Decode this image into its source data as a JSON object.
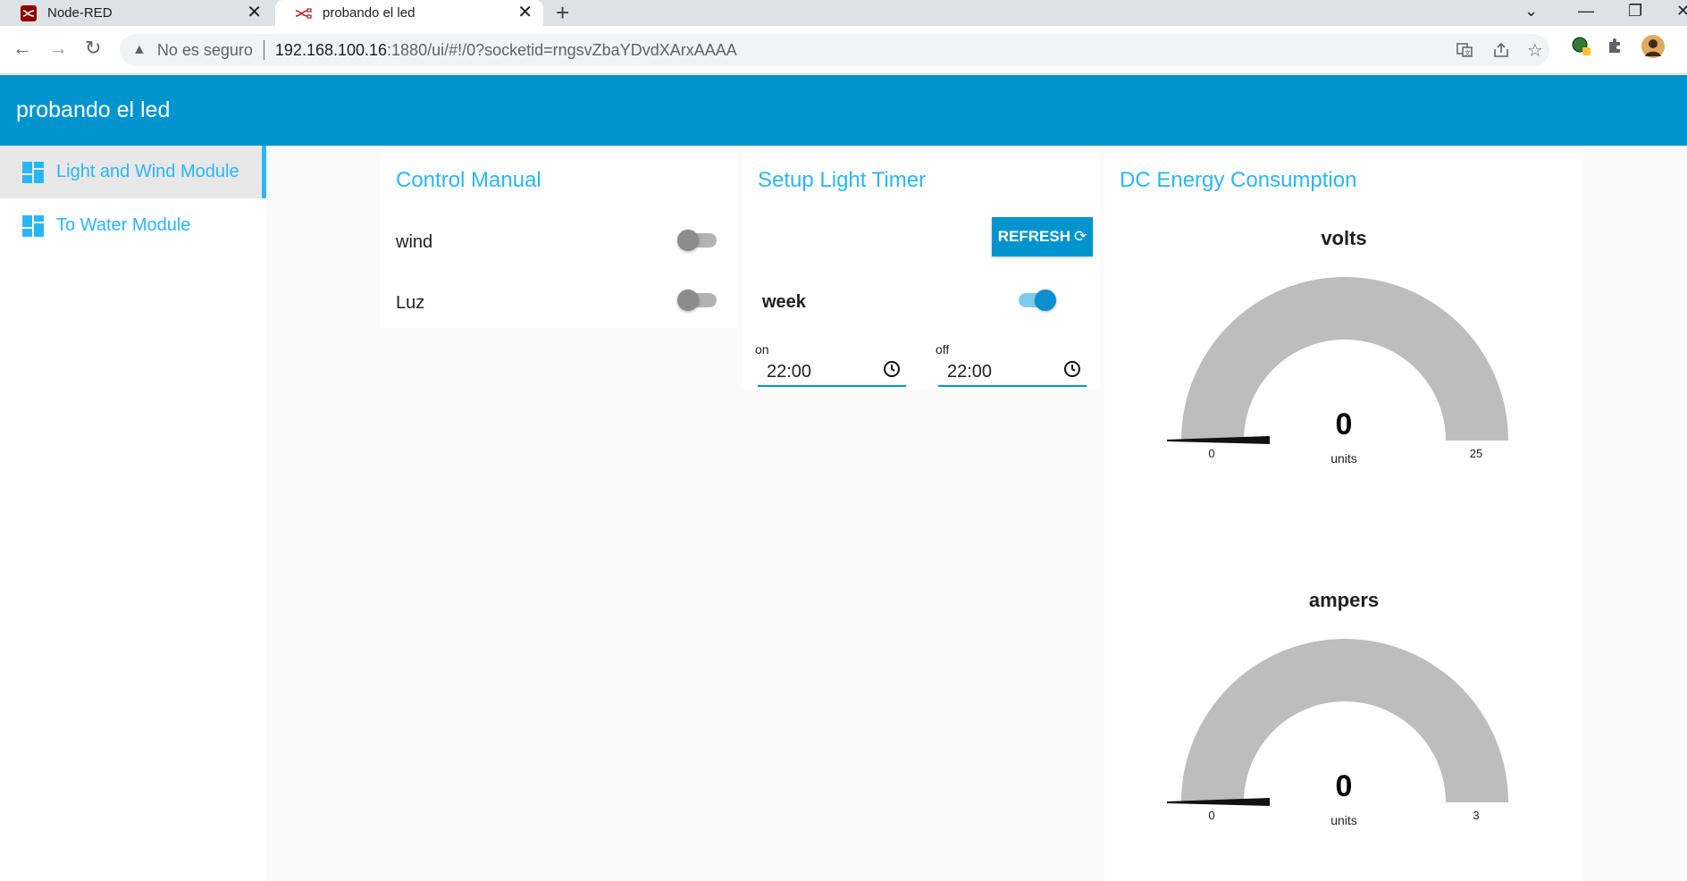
{
  "browser": {
    "tabs": [
      {
        "title": "Node-RED"
      },
      {
        "title": "probando el led"
      }
    ],
    "security_label": "No es seguro",
    "url_host": "192.168.100.16",
    "url_path": ":1880/ui/#!/0?socketid=rngsvZbaYDvdXArxAAAA"
  },
  "header": {
    "title": "probando el led"
  },
  "sidebar": {
    "items": [
      {
        "label": "Light and Wind Module",
        "active": true
      },
      {
        "label": "To Water Module",
        "active": false
      }
    ]
  },
  "control_manual": {
    "title": "Control Manual",
    "switches": [
      {
        "label": "wind",
        "on": false
      },
      {
        "label": "Luz",
        "on": false
      }
    ]
  },
  "light_timer": {
    "title": "Setup Light Timer",
    "refresh_label": "REFRESH",
    "week_label": "week",
    "week_on": true,
    "on_label": "on",
    "on_value": "22:00",
    "off_label": "off",
    "off_value": "22:00"
  },
  "energy": {
    "title": "DC Energy Consumption",
    "gauges": [
      {
        "title": "volts",
        "value": "0",
        "units": "units",
        "min": "0",
        "max": "25"
      },
      {
        "title": "ampers",
        "value": "0",
        "units": "units",
        "min": "0",
        "max": "3"
      }
    ]
  },
  "colors": {
    "accent": "#0094ce",
    "label_blue": "#29b6f6",
    "gauge_fill": "#bdbdbd"
  }
}
